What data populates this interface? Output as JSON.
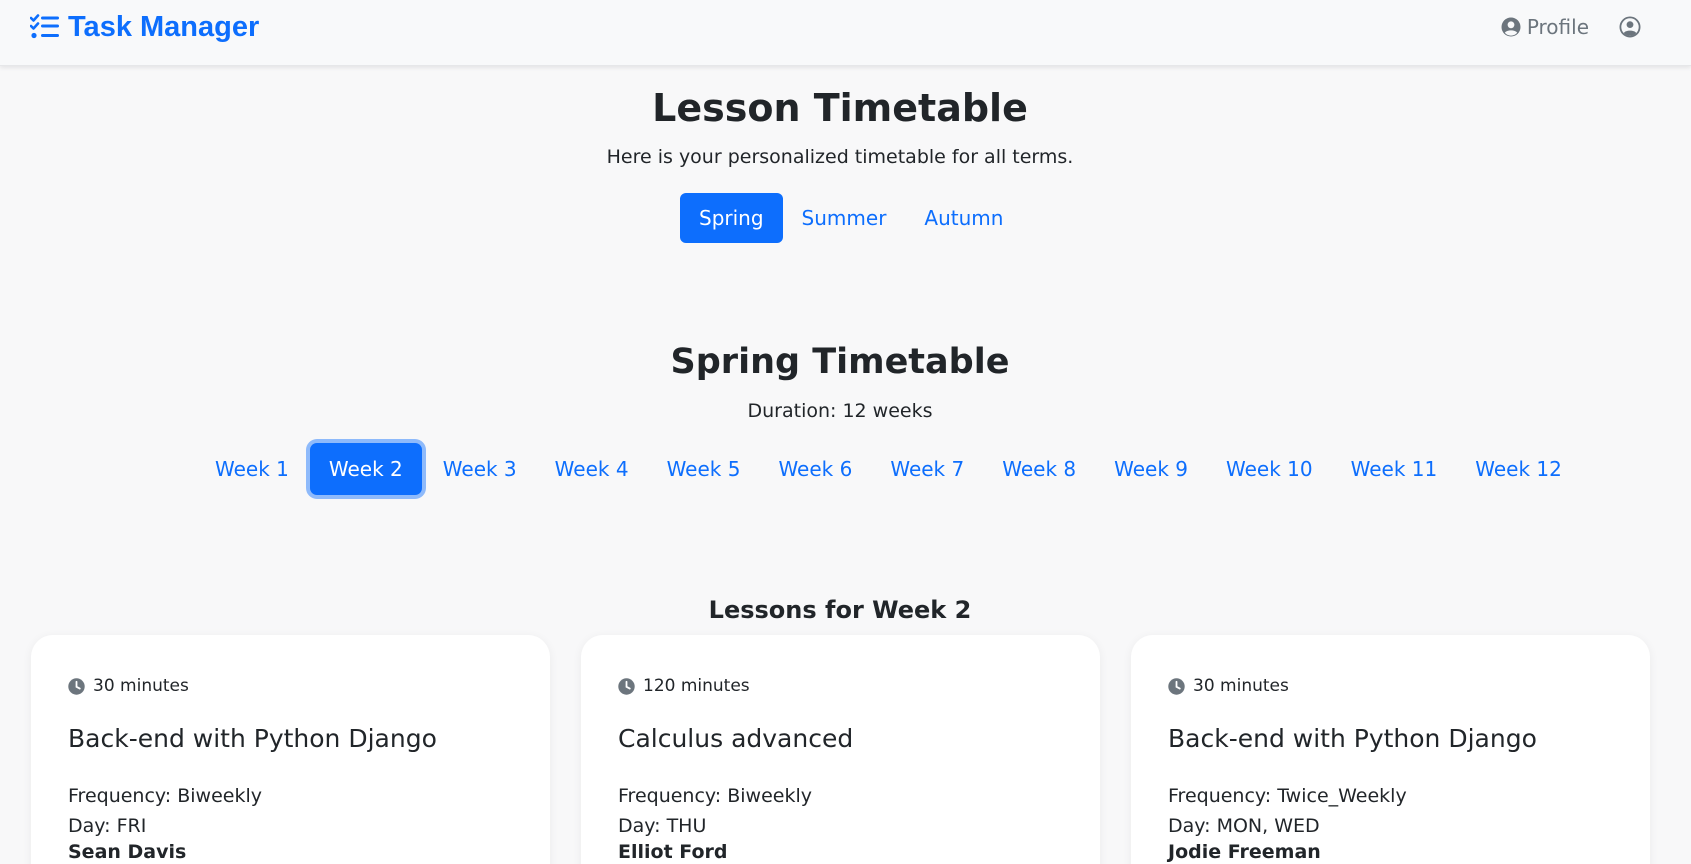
{
  "navbar": {
    "brand": "Task Manager",
    "profile_label": "Profile"
  },
  "header": {
    "title": "Lesson Timetable",
    "subtitle": "Here is your personalized timetable for all terms."
  },
  "terms": [
    {
      "label": "Spring",
      "active": true
    },
    {
      "label": "Summer",
      "active": false
    },
    {
      "label": "Autumn",
      "active": false
    }
  ],
  "term_section": {
    "title": "Spring Timetable",
    "duration": "Duration: 12 weeks"
  },
  "weeks": [
    "Week 1",
    "Week 2",
    "Week 3",
    "Week 4",
    "Week 5",
    "Week 6",
    "Week 7",
    "Week 8",
    "Week 9",
    "Week 10",
    "Week 11",
    "Week 12"
  ],
  "selected_week": "Week 2",
  "lessons_title": "Lessons for Week 2",
  "lessons": [
    {
      "duration": "30 minutes",
      "title": "Back-end with Python Django",
      "frequency": "Frequency: Biweekly",
      "day": "Day: FRI",
      "teacher": "Sean Davis"
    },
    {
      "duration": "120 minutes",
      "title": "Calculus advanced",
      "frequency": "Frequency: Biweekly",
      "day": "Day: THU",
      "teacher": "Elliot Ford"
    },
    {
      "duration": "30 minutes",
      "title": "Back-end with Python Django",
      "frequency": "Frequency: Twice_Weekly",
      "day": "Day: MON, WED",
      "teacher": "Jodie Freeman"
    }
  ],
  "colors": {
    "accent": "#0d6efd",
    "background": "#f8f8f9",
    "text": "#212529",
    "muted": "#6c757d"
  }
}
